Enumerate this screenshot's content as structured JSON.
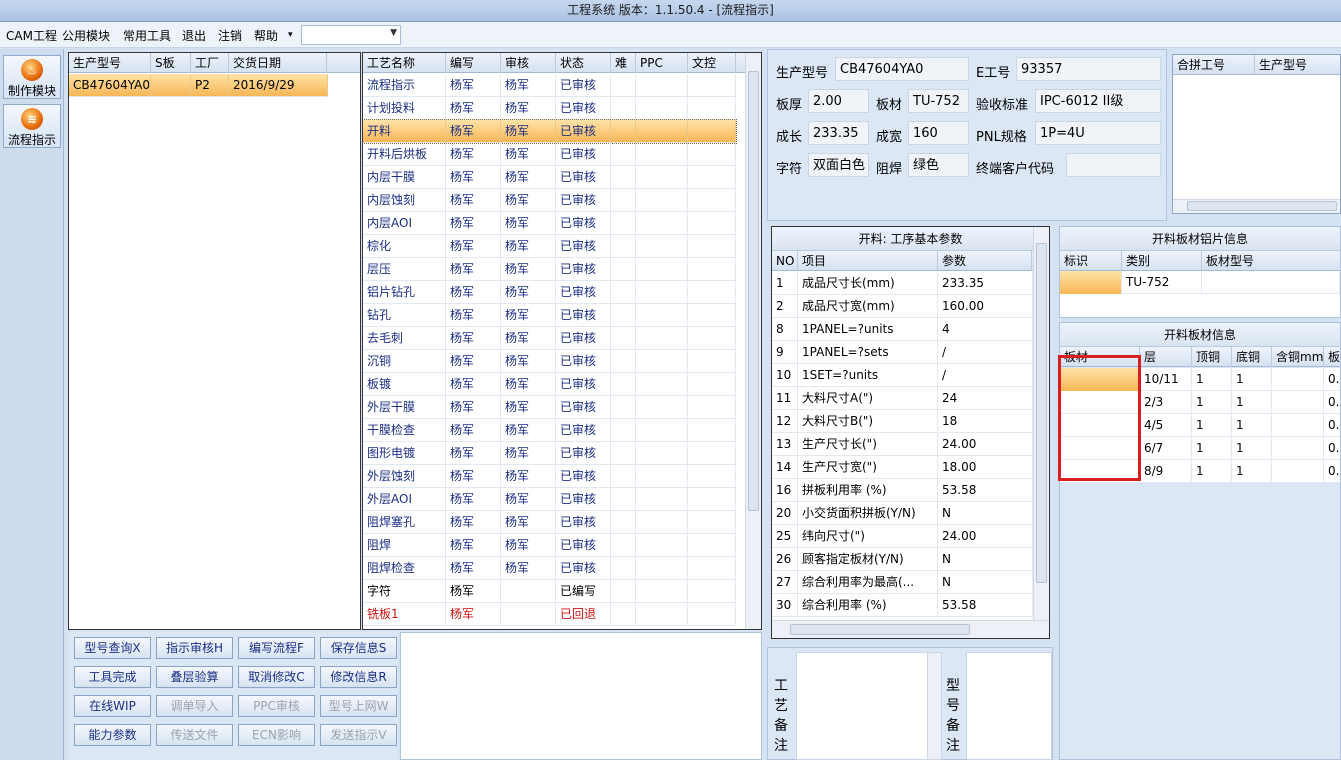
{
  "window": {
    "title": "工程系统   版本：1.1.50.4 - [流程指示]"
  },
  "menu": {
    "items": [
      "CAM工程",
      "公用模块",
      "常用工具",
      "退出",
      "注销",
      "帮助"
    ],
    "help_arrow": "▾",
    "combo_value": ""
  },
  "sidebar": {
    "items": [
      {
        "label": "制作模块",
        "icon": "flame-icon"
      },
      {
        "label": "流程指示",
        "icon": "flow-icon"
      }
    ]
  },
  "order_list": {
    "columns": [
      "生产型号",
      "S板",
      "工厂",
      "交货日期"
    ],
    "rows": [
      {
        "model": "CB47604YA0",
        "s": "",
        "factory": "P2",
        "date": "2016/9/29"
      }
    ]
  },
  "process_list": {
    "columns": [
      "工艺名称",
      "编写",
      "审核",
      "状态",
      "难",
      "PPC",
      "文控"
    ],
    "rows": [
      {
        "name": "流程指示",
        "writer": "杨军",
        "reviewer": "杨军",
        "status": "已审核"
      },
      {
        "name": "计划投料",
        "writer": "杨军",
        "reviewer": "杨军",
        "status": "已审核"
      },
      {
        "name": "开料",
        "writer": "杨军",
        "reviewer": "杨军",
        "status": "已审核",
        "selected": true
      },
      {
        "name": "开料后烘板",
        "writer": "杨军",
        "reviewer": "杨军",
        "status": "已审核"
      },
      {
        "name": "内层干膜",
        "writer": "杨军",
        "reviewer": "杨军",
        "status": "已审核"
      },
      {
        "name": "内层蚀刻",
        "writer": "杨军",
        "reviewer": "杨军",
        "status": "已审核"
      },
      {
        "name": "内层AOI",
        "writer": "杨军",
        "reviewer": "杨军",
        "status": "已审核"
      },
      {
        "name": "棕化",
        "writer": "杨军",
        "reviewer": "杨军",
        "status": "已审核"
      },
      {
        "name": "层压",
        "writer": "杨军",
        "reviewer": "杨军",
        "status": "已审核"
      },
      {
        "name": "铝片钻孔",
        "writer": "杨军",
        "reviewer": "杨军",
        "status": "已审核"
      },
      {
        "name": "钻孔",
        "writer": "杨军",
        "reviewer": "杨军",
        "status": "已审核"
      },
      {
        "name": "去毛刺",
        "writer": "杨军",
        "reviewer": "杨军",
        "status": "已审核"
      },
      {
        "name": "沉铜",
        "writer": "杨军",
        "reviewer": "杨军",
        "status": "已审核"
      },
      {
        "name": "板镀",
        "writer": "杨军",
        "reviewer": "杨军",
        "status": "已审核"
      },
      {
        "name": "外层干膜",
        "writer": "杨军",
        "reviewer": "杨军",
        "status": "已审核"
      },
      {
        "name": "干膜检查",
        "writer": "杨军",
        "reviewer": "杨军",
        "status": "已审核"
      },
      {
        "name": "图形电镀",
        "writer": "杨军",
        "reviewer": "杨军",
        "status": "已审核"
      },
      {
        "name": "外层蚀刻",
        "writer": "杨军",
        "reviewer": "杨军",
        "status": "已审核"
      },
      {
        "name": "外层AOI",
        "writer": "杨军",
        "reviewer": "杨军",
        "status": "已审核"
      },
      {
        "name": "阻焊塞孔",
        "writer": "杨军",
        "reviewer": "杨军",
        "status": "已审核"
      },
      {
        "name": "阻焊",
        "writer": "杨军",
        "reviewer": "杨军",
        "status": "已审核"
      },
      {
        "name": "阻焊检查",
        "writer": "杨军",
        "reviewer": "杨军",
        "status": "已审核"
      },
      {
        "name": "字符",
        "writer": "杨军",
        "reviewer": "",
        "status": "已编写",
        "style": "black"
      },
      {
        "name": "铣板1",
        "writer": "杨军",
        "reviewer": "",
        "status": "已回退",
        "style": "red"
      }
    ]
  },
  "toolbar": {
    "buttons": [
      {
        "label": "型号查询X",
        "enabled": true
      },
      {
        "label": "指示审核H",
        "enabled": true
      },
      {
        "label": "编写流程F",
        "enabled": true
      },
      {
        "label": "保存信息S",
        "enabled": true
      },
      {
        "label": "工具完成",
        "enabled": true
      },
      {
        "label": "叠层验算",
        "enabled": true
      },
      {
        "label": "取消修改C",
        "enabled": true
      },
      {
        "label": "修改信息R",
        "enabled": true
      },
      {
        "label": "在线WIP",
        "enabled": true
      },
      {
        "label": "调单导入",
        "enabled": false
      },
      {
        "label": "PPC审核",
        "enabled": false
      },
      {
        "label": "型号上网W",
        "enabled": false
      },
      {
        "label": "能力参数",
        "enabled": true
      },
      {
        "label": "传送文件",
        "enabled": false
      },
      {
        "label": "ECN影响",
        "enabled": false
      },
      {
        "label": "发送指示V",
        "enabled": false
      }
    ]
  },
  "product_info": {
    "model_label": "生产型号",
    "model": "CB47604YA0",
    "e_label": "E工号",
    "e_value": "93357",
    "thickness_label": "板厚",
    "thickness": "2.00",
    "material_label": "板材",
    "material": "TU-752",
    "standard_label": "验收标准",
    "standard": "IPC-6012 II级",
    "length_label": "成长",
    "length": "233.35",
    "width_label": "成宽",
    "width": "160",
    "pnl_label": "PNL规格",
    "pnl": "1P=4U",
    "char_label": "字符",
    "char": "双面白色",
    "mask_label": "阻焊",
    "mask": "绿色",
    "customer_label": "终端客户代码",
    "customer": ""
  },
  "combined": {
    "columns": [
      "合拼工号",
      "生产型号"
    ]
  },
  "params": {
    "title": "开料: 工序基本参数",
    "columns": [
      "NO",
      "项目",
      "参数"
    ],
    "rows": [
      {
        "no": "1",
        "item": "成品尺寸长(mm)",
        "value": "233.35"
      },
      {
        "no": "2",
        "item": "成品尺寸宽(mm)",
        "value": "160.00"
      },
      {
        "no": "8",
        "item": "1PANEL=?units",
        "value": "4"
      },
      {
        "no": "9",
        "item": "1PANEL=?sets",
        "value": "/"
      },
      {
        "no": "10",
        "item": "1SET=?units",
        "value": "/"
      },
      {
        "no": "11",
        "item": "大料尺寸A(\")",
        "value": "24"
      },
      {
        "no": "12",
        "item": "大料尺寸B(\")",
        "value": "18"
      },
      {
        "no": "13",
        "item": "生产尺寸长(\")",
        "value": "24.00"
      },
      {
        "no": "14",
        "item": "生产尺寸宽(\")",
        "value": "18.00"
      },
      {
        "no": "16",
        "item": "拼板利用率 (%)",
        "value": "53.58"
      },
      {
        "no": "20",
        "item": "小交货面积拼板(Y/N)",
        "value": "N"
      },
      {
        "no": "25",
        "item": "纬向尺寸(\")",
        "value": "24.00"
      },
      {
        "no": "26",
        "item": "顾客指定板材(Y/N)",
        "value": "N"
      },
      {
        "no": "27",
        "item": "综合利用率为最高(...",
        "value": "N"
      },
      {
        "no": "30",
        "item": "综合利用率 (%)",
        "value": "53.58"
      }
    ]
  },
  "alu_info": {
    "title": "开料板材铝片信息",
    "columns": [
      "标识",
      "类别",
      "板材型号"
    ],
    "rows": [
      {
        "mark": "",
        "type": "TU-752",
        "model": ""
      }
    ]
  },
  "board_info": {
    "title": "开料板材信息",
    "columns": [
      "板材",
      "层",
      "顶铜",
      "底铜",
      "含铜mm",
      "板"
    ],
    "rows": [
      {
        "board": "",
        "layer": "10/11",
        "top": "1",
        "bottom": "1",
        "cu": "",
        "b": "0."
      },
      {
        "board": "",
        "layer": "2/3",
        "top": "1",
        "bottom": "1",
        "cu": "",
        "b": "0."
      },
      {
        "board": "",
        "layer": "4/5",
        "top": "1",
        "bottom": "1",
        "cu": "",
        "b": "0."
      },
      {
        "board": "",
        "layer": "6/7",
        "top": "1",
        "bottom": "1",
        "cu": "",
        "b": "0."
      },
      {
        "board": "",
        "layer": "8/9",
        "top": "1",
        "bottom": "1",
        "cu": "",
        "b": "0."
      }
    ]
  },
  "notes": {
    "process_label": "工艺备注",
    "model_label": "型号备注"
  },
  "colors": {
    "selected_row": "#f7b655",
    "highlight_box": "#d81e1e",
    "link_text": "#1c2f86",
    "error_text": "#d01010"
  }
}
